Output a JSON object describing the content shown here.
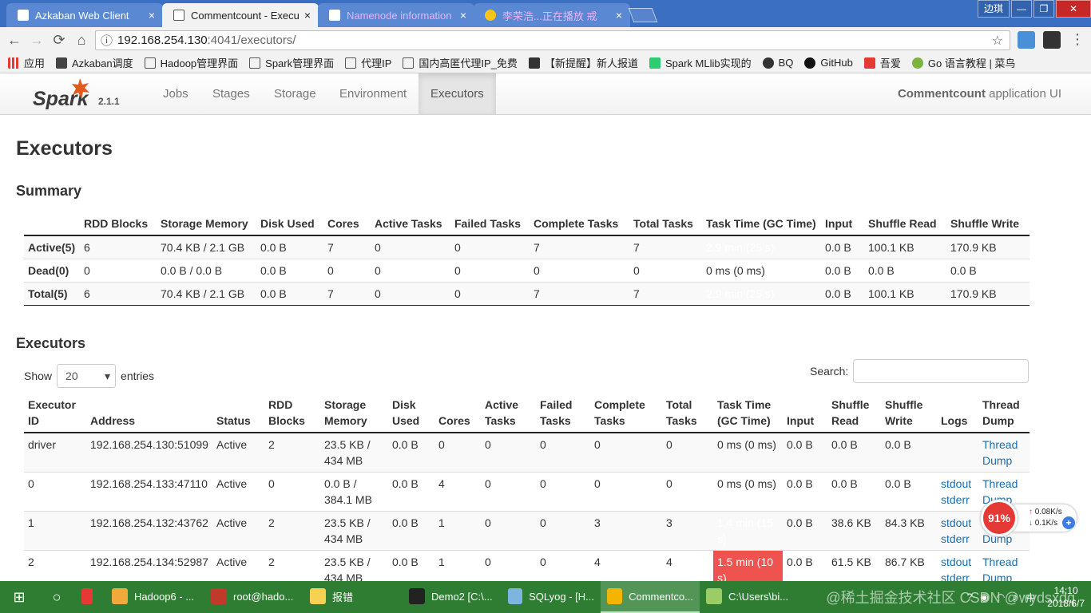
{
  "browser": {
    "tabs": [
      {
        "title": "Azkaban Web Client",
        "close": "×",
        "active": false,
        "icon_color": "#ffffff"
      },
      {
        "title": "Commentcount - Executors",
        "close": "×",
        "active": true,
        "icon_color": "#555555"
      },
      {
        "title": "Namenode information",
        "close": "×",
        "active": false,
        "icon_color": "#ffffff"
      },
      {
        "title": "李荣浩...正在播放 戒",
        "close": "×",
        "active": false,
        "icon_color": "#f5c518"
      }
    ],
    "window_buttons": [
      "边琪",
      "—",
      "❐",
      "✕"
    ],
    "url_host": "192.168.254.130",
    "url_path": ":4041/executors/",
    "info_icon": "ⓘ",
    "bookmarks": [
      {
        "label": "应用",
        "icon": "apps-icon"
      },
      {
        "label": "Azkaban调度",
        "icon": "azkaban-icon"
      },
      {
        "label": "Hadoop管理界面",
        "icon": "page-icon"
      },
      {
        "label": "Spark管理界面",
        "icon": "page-icon"
      },
      {
        "label": "代理IP",
        "icon": "page-icon"
      },
      {
        "label": "国内高匿代理IP_免费",
        "icon": "page-icon"
      },
      {
        "label": "【新提醒】新人报道",
        "icon": "forum-icon"
      },
      {
        "label": "Spark MLlib实现的",
        "icon": "lxw-icon"
      },
      {
        "label": "BQ",
        "icon": "bq-icon"
      },
      {
        "label": "GitHub",
        "icon": "github-icon"
      },
      {
        "label": "吾爱",
        "icon": "wuai-icon"
      },
      {
        "label": "Go 语言教程 | 菜鸟",
        "icon": "runoob-icon"
      }
    ]
  },
  "spark": {
    "version": "2.1.1",
    "nav": [
      {
        "label": "Jobs",
        "active": false
      },
      {
        "label": "Stages",
        "active": false
      },
      {
        "label": "Storage",
        "active": false
      },
      {
        "label": "Environment",
        "active": false
      },
      {
        "label": "Executors",
        "active": true
      }
    ],
    "app_name": "Commentcount",
    "app_suffix": " application UI",
    "page_title": "Executors",
    "summary_title": "Summary",
    "executors_title": "Executors",
    "summary_headers": [
      "",
      "RDD Blocks",
      "Storage Memory",
      "Disk Used",
      "Cores",
      "Active Tasks",
      "Failed Tasks",
      "Complete Tasks",
      "Total Tasks",
      "Task Time (GC Time)",
      "Input",
      "Shuffle Read",
      "Shuffle Write"
    ],
    "summary_rows": [
      {
        "cells": [
          "Active(5)",
          "6",
          "70.4 KB / 2.1 GB",
          "0.0 B",
          "7",
          "0",
          "0",
          "7",
          "7",
          "2.9 min (25 s)",
          "0.0 B",
          "100.1 KB",
          "170.9 KB"
        ],
        "hot": true
      },
      {
        "cells": [
          "Dead(0)",
          "0",
          "0.0 B / 0.0 B",
          "0.0 B",
          "0",
          "0",
          "0",
          "0",
          "0",
          "0 ms (0 ms)",
          "0.0 B",
          "0.0 B",
          "0.0 B"
        ],
        "hot": false
      },
      {
        "cells": [
          "Total(5)",
          "6",
          "70.4 KB / 2.1 GB",
          "0.0 B",
          "7",
          "0",
          "0",
          "7",
          "7",
          "2.9 min (25 s)",
          "0.0 B",
          "100.1 KB",
          "170.9 KB"
        ],
        "hot": true
      }
    ],
    "show_label": "Show",
    "entries_value": "20",
    "entries_label": "entries",
    "search_label": "Search:",
    "search_value": "",
    "exec_headers": [
      "Executor ID",
      "Address",
      "Status",
      "RDD Blocks",
      "Storage Memory",
      "Disk Used",
      "Cores",
      "Active Tasks",
      "Failed Tasks",
      "Complete Tasks",
      "Total Tasks",
      "Task Time (GC Time)",
      "Input",
      "Shuffle Read",
      "Shuffle Write",
      "Logs",
      "Thread Dump"
    ],
    "exec_rows": [
      {
        "id": "driver",
        "address": "192.168.254.130:51099",
        "status": "Active",
        "rdd": "2",
        "storage": "23.5 KB / 434 MB",
        "disk": "0.0 B",
        "cores": "0",
        "active": "0",
        "failed": "0",
        "complete": "0",
        "total": "0",
        "time": "0 ms (0 ms)",
        "hot": false,
        "input": "0.0 B",
        "sread": "0.0 B",
        "swrite": "0.0 B",
        "stdout": "",
        "stderr": "",
        "dump": "Thread Dump"
      },
      {
        "id": "0",
        "address": "192.168.254.133:47110",
        "status": "Active",
        "rdd": "0",
        "storage": "0.0 B / 384.1 MB",
        "disk": "0.0 B",
        "cores": "4",
        "active": "0",
        "failed": "0",
        "complete": "0",
        "total": "0",
        "time": "0 ms (0 ms)",
        "hot": false,
        "input": "0.0 B",
        "sread": "0.0 B",
        "swrite": "0.0 B",
        "stdout": "stdout",
        "stderr": "stderr",
        "dump": "Thread Dump"
      },
      {
        "id": "1",
        "address": "192.168.254.132:43762",
        "status": "Active",
        "rdd": "2",
        "storage": "23.5 KB / 434 MB",
        "disk": "0.0 B",
        "cores": "1",
        "active": "0",
        "failed": "0",
        "complete": "3",
        "total": "3",
        "time": "1.4 min (15 s)",
        "hot": true,
        "input": "0.0 B",
        "sread": "38.6 KB",
        "swrite": "84.3 KB",
        "stdout": "stdout",
        "stderr": "stderr",
        "dump": "Thread Dump"
      },
      {
        "id": "2",
        "address": "192.168.254.134:52987",
        "status": "Active",
        "rdd": "2",
        "storage": "23.5 KB / 434 MB",
        "disk": "0.0 B",
        "cores": "1",
        "active": "0",
        "failed": "0",
        "complete": "4",
        "total": "4",
        "time": "1.5 min (10 s)",
        "hot": true,
        "input": "0.0 B",
        "sread": "61.5 KB",
        "swrite": "86.7 KB",
        "stdout": "stdout",
        "stderr": "stderr",
        "dump": "Thread Dump"
      }
    ]
  },
  "netwidget": {
    "percent": "91%",
    "up": "0.08K/s",
    "down": "0.1K/s",
    "plus": "+"
  },
  "taskbar": {
    "items": [
      {
        "label": "",
        "icon_color": "#e53935",
        "icon": "netease-music-icon"
      },
      {
        "label": "Hadoop6 - ...",
        "icon_color": "#f2a93b",
        "icon": "vm-icon"
      },
      {
        "label": "root@hado...",
        "icon_color": "#c0392b",
        "icon": "terminal-icon"
      },
      {
        "label": "报错",
        "icon_color": "#f7d154",
        "icon": "folder-icon"
      },
      {
        "label": "Demo2 [C:\\...",
        "icon_color": "#222222",
        "icon": "intellij-icon"
      },
      {
        "label": "SQLyog - [H...",
        "icon_color": "#7fb3e0",
        "icon": "sqlyog-icon"
      },
      {
        "label": "Commentco...",
        "icon_color": "#f4b400",
        "icon": "chrome-icon"
      },
      {
        "label": "C:\\Users\\bi...",
        "icon_color": "#9ccc65",
        "icon": "cmd-icon"
      }
    ],
    "tray_lang": "中",
    "time": "14:10",
    "date": "2018/6/7",
    "watermark": "@稀土掘金技术社区 CSDN @wydsxdq"
  },
  "colors": {
    "accent": "#ef5350",
    "link": "#1a6dac",
    "taskbar": "#2e7d32",
    "tabstrip": "#3a6fc2"
  }
}
